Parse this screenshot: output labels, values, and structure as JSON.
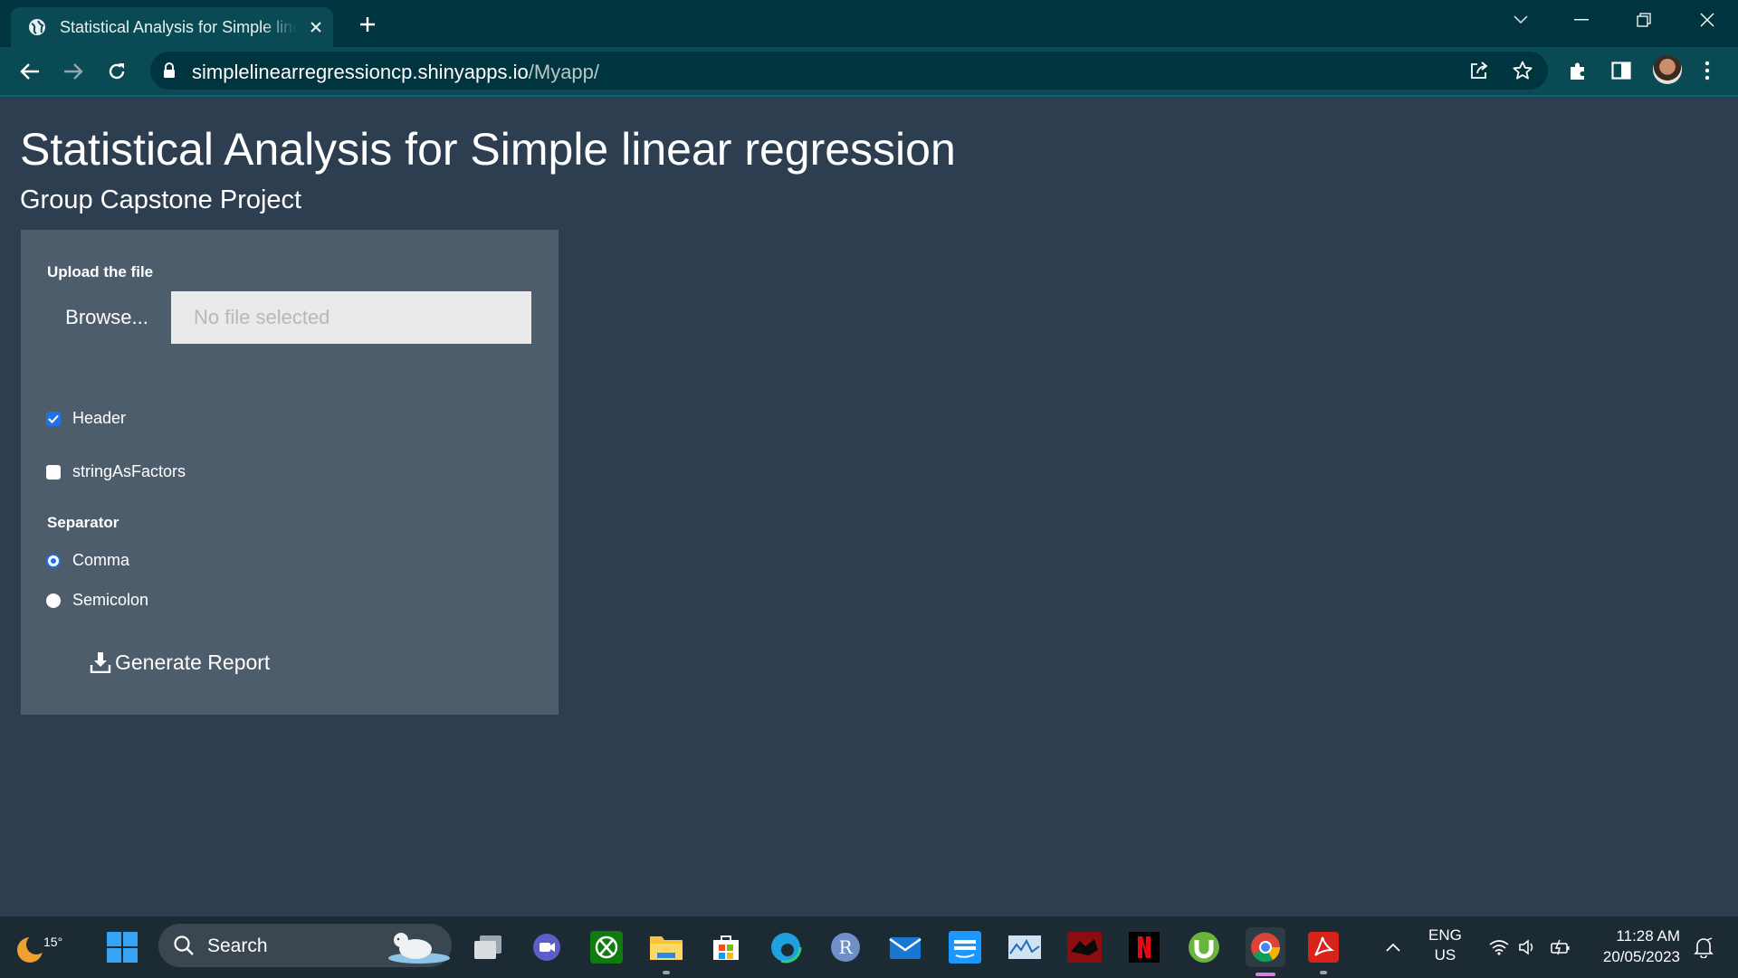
{
  "browser": {
    "tab_title": "Statistical Analysis for Simple linear regression",
    "url_host": "simplelinearregressioncp.shinyapps.io",
    "url_path": "/Myapp/"
  },
  "app": {
    "title": "Statistical Analysis for Simple linear regression",
    "subtitle": "Group Capstone Project",
    "upload": {
      "label": "Upload the file",
      "button_label": "Browse...",
      "placeholder": "No file selected"
    },
    "options": [
      {
        "label": "Header",
        "checked": true
      },
      {
        "label": "stringAsFactors",
        "checked": false
      }
    ],
    "separator": {
      "label": "Separator",
      "choices": [
        {
          "label": "Comma",
          "selected": true
        },
        {
          "label": "Semicolon",
          "selected": false
        }
      ]
    },
    "generate_label": "Generate Report"
  },
  "taskbar": {
    "weather_temp": "15°",
    "search_label": "Search",
    "language": "ENG",
    "region": "US",
    "time": "11:28 AM",
    "date": "20/05/2023"
  },
  "colors": {
    "page_bg": "#2c3e50",
    "panel_bg": "#4e5d6c",
    "accent": "#1f73e6",
    "chrome_tabstrip": "#00343f",
    "chrome_toolbar": "#0a4a55"
  }
}
